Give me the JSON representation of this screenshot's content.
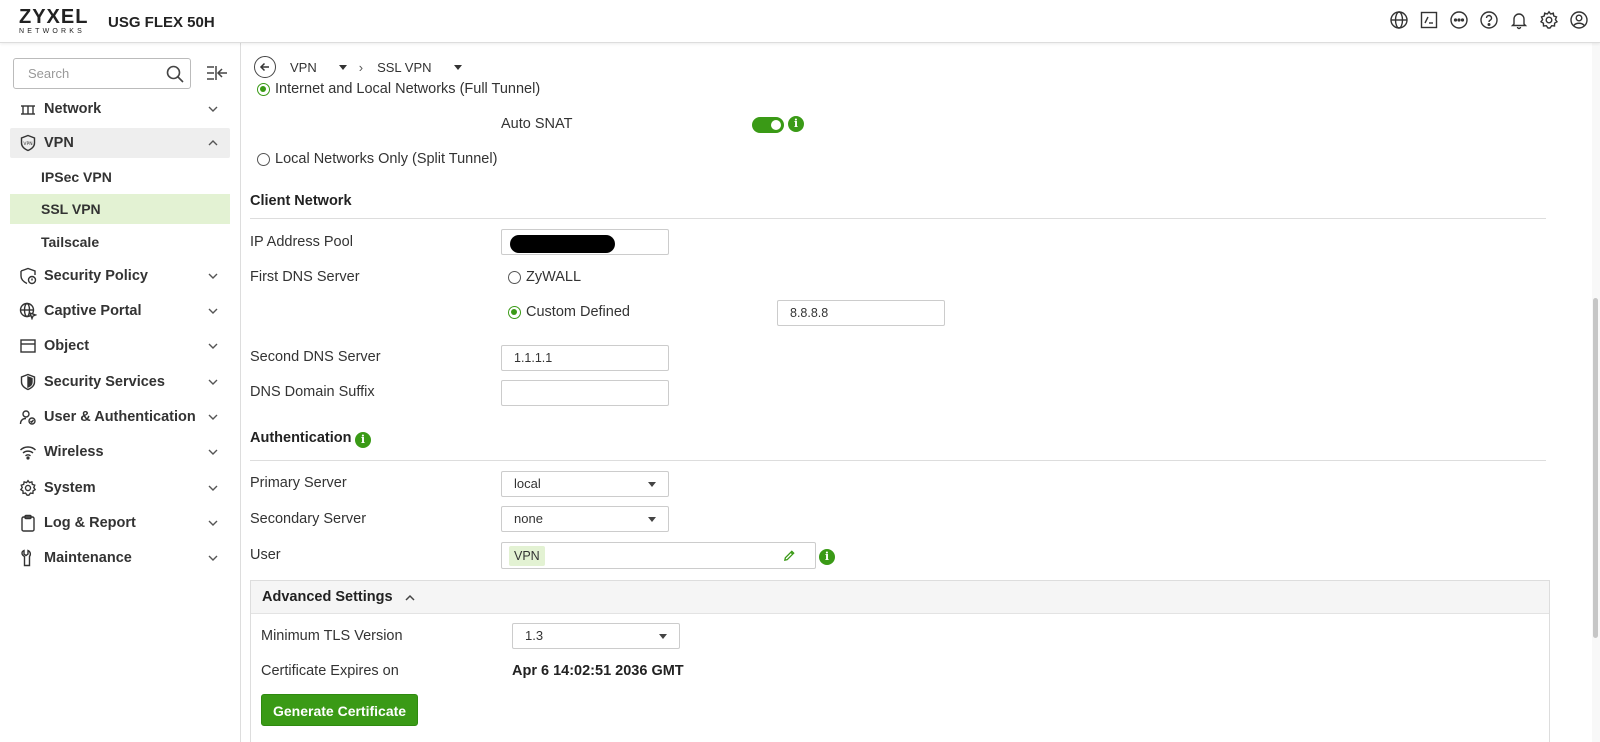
{
  "header": {
    "logo_main": "ZYXEL",
    "logo_sub": "NETWORKS",
    "model": "USG FLEX 50H",
    "icons": [
      "globe-icon",
      "terminal-icon",
      "more-icon",
      "help-icon",
      "bell-icon",
      "gear-icon",
      "user-icon"
    ]
  },
  "sidebar": {
    "search_placeholder": "Search",
    "items": [
      {
        "label": "Network",
        "icon": "network-icon"
      },
      {
        "label": "VPN",
        "icon": "vpn-shield-icon"
      },
      {
        "label": "Security Policy",
        "icon": "security-policy-icon"
      },
      {
        "label": "Captive Portal",
        "icon": "captive-portal-icon"
      },
      {
        "label": "Object",
        "icon": "object-icon"
      },
      {
        "label": "Security Services",
        "icon": "security-services-icon"
      },
      {
        "label": "User & Authentication",
        "icon": "user-auth-icon"
      },
      {
        "label": "Wireless",
        "icon": "wifi-icon"
      },
      {
        "label": "System",
        "icon": "system-gear-icon"
      },
      {
        "label": "Log & Report",
        "icon": "clipboard-icon"
      },
      {
        "label": "Maintenance",
        "icon": "wrench-icon"
      }
    ],
    "vpn_sub": [
      "IPSec VPN",
      "SSL VPN",
      "Tailscale"
    ],
    "selected_sub": "SSL VPN"
  },
  "breadcrumb": {
    "level1": "VPN",
    "level2": "SSL VPN",
    "separator": "›"
  },
  "tunnel": {
    "full_tunnel_label": "Internet and Local Networks (Full Tunnel)",
    "auto_snat_label": "Auto SNAT",
    "auto_snat_on": true,
    "split_tunnel_label": "Local Networks Only (Split Tunnel)"
  },
  "client_network": {
    "title": "Client Network",
    "ip_pool_label": "IP Address Pool",
    "first_dns_label": "First DNS Server",
    "dns_opt1": "ZyWALL",
    "dns_opt2": "Custom Defined",
    "custom_dns_value": "8.8.8.8",
    "second_dns_label": "Second DNS Server",
    "second_dns_value": "1.1.1.1",
    "domain_suffix_label": "DNS Domain Suffix",
    "domain_suffix_value": ""
  },
  "authentication": {
    "title": "Authentication",
    "primary_label": "Primary Server",
    "primary_value": "local",
    "secondary_label": "Secondary Server",
    "secondary_value": "none",
    "user_label": "User",
    "user_tag": "VPN"
  },
  "advanced": {
    "title": "Advanced Settings",
    "min_tls_label": "Minimum TLS Version",
    "min_tls_value": "1.3",
    "cert_exp_label": "Certificate Expires on",
    "cert_exp_value": "Apr 6 14:02:51 2036 GMT",
    "generate_button": "Generate Certificate"
  },
  "colors": {
    "accent": "#3a9a16",
    "selected_bg": "#e3f2d3"
  }
}
